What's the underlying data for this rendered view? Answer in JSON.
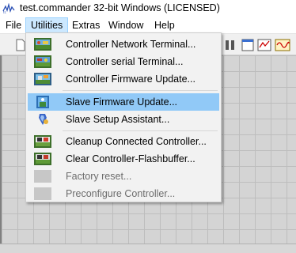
{
  "window": {
    "title": "test.commander 32-bit Windows  (LICENSED)"
  },
  "menubar": {
    "items": [
      {
        "label": "File"
      },
      {
        "label": "Utilities"
      },
      {
        "label": "Extras"
      },
      {
        "label": "Window"
      },
      {
        "label": "Help"
      }
    ]
  },
  "utilities_menu": {
    "items": [
      {
        "label": "Controller Network Terminal...",
        "icon": "network-terminal-icon",
        "enabled": true
      },
      {
        "label": "Controller serial Terminal...",
        "icon": "serial-terminal-icon",
        "enabled": true
      },
      {
        "label": "Controller Firmware Update...",
        "icon": "controller-firmware-icon",
        "enabled": true
      },
      {
        "label": "Slave Firmware Update...",
        "icon": "slave-firmware-icon",
        "enabled": true,
        "highlighted": true
      },
      {
        "label": "Slave Setup Assistant...",
        "icon": "setup-assistant-icon",
        "enabled": true
      },
      {
        "label": "Cleanup Connected Controller...",
        "icon": "cleanup-controller-icon",
        "enabled": true
      },
      {
        "label": "Clear Controller-Flashbuffer...",
        "icon": "clear-flashbuffer-icon",
        "enabled": true
      },
      {
        "label": "Factory reset...",
        "icon": "factory-reset-icon",
        "enabled": false
      },
      {
        "label": "Preconfigure Controller...",
        "icon": "preconfigure-icon",
        "enabled": false
      }
    ]
  },
  "colors": {
    "menu_highlight": "#91c9f7",
    "menubar_active": "#cce8ff",
    "disabled_text": "#6d6d6d"
  }
}
